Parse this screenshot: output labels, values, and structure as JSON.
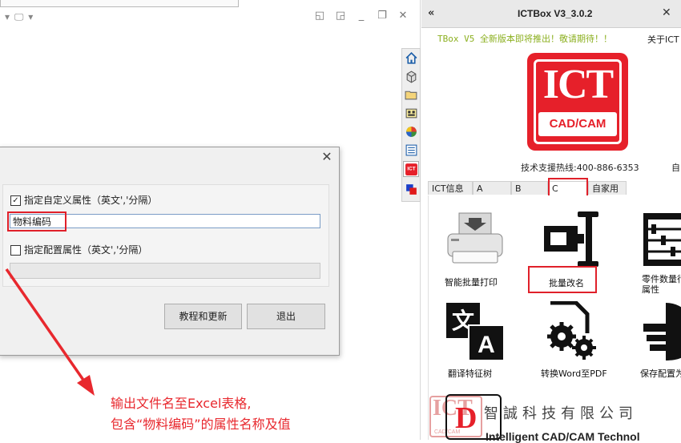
{
  "cad": {
    "view_controls": [
      "▾",
      "🖵",
      "▾"
    ],
    "window_buttons": [
      "◱",
      "◲",
      "_",
      "❐",
      "✕"
    ]
  },
  "dialog": {
    "close": "✕",
    "custom_attr_checked": "✓",
    "custom_attr_label": "指定自定义属性（英文','分隔）",
    "custom_attr_value": "物料编码",
    "config_attr_label": "指定配置属性（英文','分隔）",
    "config_attr_value": "",
    "btn_tutorial": "教程和更新",
    "btn_exit": "退出"
  },
  "annotation": {
    "line1": "输出文件名至Excel表格,",
    "line2": "包含“物料编码”的属性名称及值"
  },
  "panel": {
    "collapse": "«",
    "title": "ICTBox V3_3.0.2",
    "close": "✕",
    "notice": "TBox V5 全新版本即将推出！敬请期待！！",
    "about": "关于ICT",
    "logo_top": "ICT",
    "logo_bottom": "CAD/CAM",
    "hotline": "技术支援热线:400-886-6353",
    "hotline_extra": "自",
    "tabs": [
      "ICT信息",
      "A",
      "B",
      "C",
      "自家用"
    ],
    "active_tab": "C",
    "items": [
      {
        "label": "智能批量打印",
        "icon": "printer-icon"
      },
      {
        "label": "批量改名",
        "icon": "rename-icon"
      },
      {
        "label": "零件数量行",
        "label2": "属性",
        "icon": "abacus-icon"
      },
      {
        "label": "翻译特征树",
        "icon": "translate-icon"
      },
      {
        "label": "转换Word至PDF",
        "icon": "gears-doc-icon"
      },
      {
        "label": "保存配置为",
        "icon": "save-config-icon"
      }
    ],
    "footer_logo": "ICT",
    "footer_logo_sub": "CAD/CAM",
    "footer_letter": "D",
    "company_cn": "智誠科技有限公司",
    "company_en": "Intelligent CAD/CAM Technol"
  },
  "colors": {
    "accent_red": "#e0202a",
    "notice_green": "#8cb020"
  }
}
